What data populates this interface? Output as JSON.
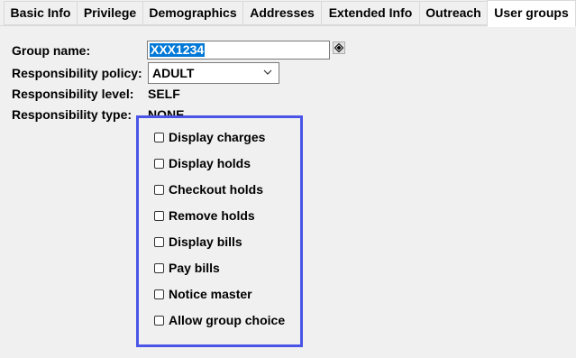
{
  "tabs": [
    {
      "label": "Basic Info"
    },
    {
      "label": "Privilege"
    },
    {
      "label": "Demographics"
    },
    {
      "label": "Addresses"
    },
    {
      "label": "Extended Info"
    },
    {
      "label": "Outreach"
    },
    {
      "label": "User groups",
      "active": true
    }
  ],
  "form": {
    "group_name_label": "Group name:",
    "group_name_value": "XXX1234",
    "policy_label": "Responsibility policy:",
    "policy_value": "ADULT",
    "level_label": "Responsibility level:",
    "level_value": "SELF",
    "type_label": "Responsibility type:",
    "type_value": "NONE"
  },
  "checkboxes": [
    {
      "label": "Display charges",
      "checked": false
    },
    {
      "label": "Display holds",
      "checked": false
    },
    {
      "label": "Checkout holds",
      "checked": false
    },
    {
      "label": "Remove holds",
      "checked": false
    },
    {
      "label": "Display bills",
      "checked": false
    },
    {
      "label": "Pay bills",
      "checked": false
    },
    {
      "label": "Notice master",
      "checked": false
    },
    {
      "label": "Allow group choice",
      "checked": false
    }
  ],
  "colors": {
    "highlight_border": "#4a55e8",
    "selection": "#0078d7"
  },
  "icons": {
    "lookup": "lookup-icon",
    "dropdown": "chevron-down-icon"
  }
}
